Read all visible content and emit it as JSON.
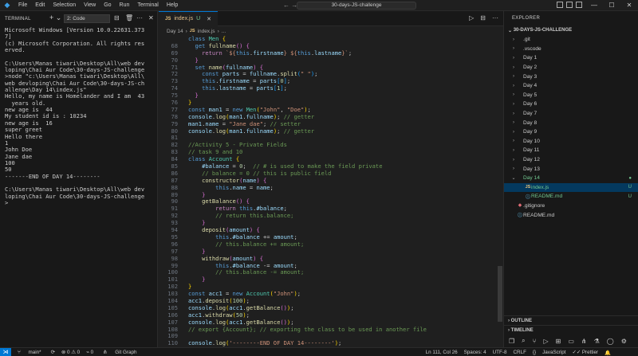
{
  "app": {
    "menu": [
      "File",
      "Edit",
      "Selection",
      "View",
      "Go",
      "Run",
      "Terminal",
      "Help"
    ],
    "search_text": "30-days-JS-challenge",
    "nav_back": "←",
    "nav_forward": "→"
  },
  "terminal": {
    "title": "TERMINAL",
    "selector": "2: Code",
    "lines": [
      "Microsoft Windows [Version 10.0.22631.373",
      "7]",
      "(c) Microsoft Corporation. All rights res",
      "erved.",
      "",
      "C:\\Users\\Manas tiwari\\Desktop\\All\\web dev",
      "loping\\Chai Aur Code\\30-days-JS-challenge",
      ">node \"c:\\Users\\Manas tiwari\\Desktop\\All\\",
      "web devloping\\Chai Aur Code\\30-days-JS-ch",
      "allenge\\Day 14\\index.js\"",
      "Hello, my name is Homelander and I am  43",
      "  years old.",
      "new age is  44",
      "My student id is : 10234",
      "new age is  16",
      "super greet",
      "Hello there",
      "1",
      "John Doe",
      "Jane dae",
      "100",
      "50",
      "-------END OF DAY 14--------",
      "",
      "C:\\Users\\Manas tiwari\\Desktop\\All\\web dev",
      "loping\\Chai Aur Code\\30-days-JS-challenge",
      ">"
    ]
  },
  "editor": {
    "tab": {
      "label": "index.js",
      "status": "U",
      "icon": "JS"
    },
    "breadcrumb": [
      "Day 14",
      "index.js",
      "..."
    ],
    "code": [
      {
        "ln": "",
        "html": "<span class=\"k\">class</span> <span class=\"c\">Men</span> <span class=\"p\">{</span>"
      },
      {
        "ln": "68",
        "html": "  <span class=\"k\">get</span> <span class=\"f\">fullname</span><span class=\"pp\">()</span> <span class=\"pp\">{</span>"
      },
      {
        "ln": "69",
        "html": "    <span class=\"kc\">return</span> <span class=\"s\">`${</span><span class=\"k\">this</span>.<span class=\"v\">firstname</span><span class=\"s\">} ${</span><span class=\"k\">this</span>.<span class=\"v\">lastname</span><span class=\"s\">}`</span>;"
      },
      {
        "ln": "70",
        "html": "  <span class=\"pp\">}</span>"
      },
      {
        "ln": "71",
        "html": "  <span class=\"k\">set</span> <span class=\"f\">name</span><span class=\"pp\">(</span><span class=\"v\">fullname</span><span class=\"pp\">)</span> <span class=\"pp\">{</span>"
      },
      {
        "ln": "72",
        "html": "    <span class=\"k\">const</span> <span class=\"v\">parts</span> = <span class=\"v\">fullname</span>.<span class=\"f\">split</span><span class=\"pb\">(</span><span class=\"s\">\" \"</span><span class=\"pb\">)</span>;"
      },
      {
        "ln": "73",
        "html": "    <span class=\"k\">this</span>.<span class=\"v\">firstname</span> = <span class=\"v\">parts</span><span class=\"pb\">[</span><span class=\"n\">0</span><span class=\"pb\">]</span>;"
      },
      {
        "ln": "74",
        "html": "    <span class=\"k\">this</span>.<span class=\"v\">lastname</span> = <span class=\"v\">parts</span><span class=\"pb\">[</span><span class=\"n\">1</span><span class=\"pb\">]</span>;"
      },
      {
        "ln": "75",
        "html": "  <span class=\"pp\">}</span>"
      },
      {
        "ln": "76",
        "html": "<span class=\"p\">}</span>"
      },
      {
        "ln": "77",
        "html": "<span class=\"k\">const</span> <span class=\"v\">man1</span> = <span class=\"k\">new</span> <span class=\"c\">Men</span><span class=\"p\">(</span><span class=\"s\">\"John\"</span>, <span class=\"s\">\"Doe\"</span><span class=\"p\">)</span>;"
      },
      {
        "ln": "78",
        "html": "<span class=\"v\">console</span>.<span class=\"f\">log</span><span class=\"p\">(</span><span class=\"v\">man1</span>.<span class=\"v\">fullname</span><span class=\"p\">)</span>; <span class=\"cm\">// getter</span>"
      },
      {
        "ln": "79",
        "html": "<span class=\"v\">man1</span>.<span class=\"v\">name</span> = <span class=\"s\">\"Jane dae\"</span>; <span class=\"cm\">// setter</span>"
      },
      {
        "ln": "80",
        "html": "<span class=\"v\">console</span>.<span class=\"f\">log</span><span class=\"p\">(</span><span class=\"v\">man1</span>.<span class=\"v\">fullname</span><span class=\"p\">)</span>; <span class=\"cm\">// getter</span>"
      },
      {
        "ln": "81",
        "html": ""
      },
      {
        "ln": "82",
        "html": "<span class=\"cm\">//Activity 5 - Private Fields</span>"
      },
      {
        "ln": "83",
        "html": "<span class=\"cm\">// task 9 and 10</span>"
      },
      {
        "ln": "84",
        "html": "<span class=\"k\">class</span> <span class=\"c\">Account</span> <span class=\"p\">{</span>"
      },
      {
        "ln": "85",
        "html": "    <span class=\"v\">#balance</span> = <span class=\"n\">0</span>;  <span class=\"cm\">// # is used to make the field private</span>"
      },
      {
        "ln": "86",
        "html": "    <span class=\"cm\">// balance = 0 // this is public field</span>"
      },
      {
        "ln": "87",
        "html": "    <span class=\"f\">constructor</span><span class=\"pp\">(</span><span class=\"v\">name</span><span class=\"pp\">)</span> <span class=\"pp\">{</span>"
      },
      {
        "ln": "88",
        "html": "        <span class=\"k\">this</span>.<span class=\"v\">name</span> = <span class=\"v\">name</span>;"
      },
      {
        "ln": "89",
        "html": "    <span class=\"pp\">}</span>"
      },
      {
        "ln": "90",
        "html": "    <span class=\"f\">getBalance</span><span class=\"pp\">()</span> <span class=\"pp\">{</span>"
      },
      {
        "ln": "91",
        "html": "        <span class=\"kc\">return</span> <span class=\"k\">this</span>.<span class=\"v\">#balance</span>;"
      },
      {
        "ln": "92",
        "html": "        <span class=\"cm\">// return this.balance;</span>"
      },
      {
        "ln": "93",
        "html": "    <span class=\"pp\">}</span>"
      },
      {
        "ln": "94",
        "html": "    <span class=\"f\">deposit</span><span class=\"pp\">(</span><span class=\"v\">amount</span><span class=\"pp\">)</span> <span class=\"pp\">{</span>"
      },
      {
        "ln": "95",
        "html": "        <span class=\"k\">this</span>.<span class=\"v\">#balance</span> += <span class=\"v\">amount</span>;"
      },
      {
        "ln": "96",
        "html": "        <span class=\"cm\">// this.balance += amount;</span>"
      },
      {
        "ln": "97",
        "html": "    <span class=\"pp\">}</span>"
      },
      {
        "ln": "98",
        "html": "    <span class=\"f\">withdraw</span><span class=\"pp\">(</span><span class=\"v\">amount</span><span class=\"pp\">)</span> <span class=\"pp\">{</span>"
      },
      {
        "ln": "99",
        "html": "        <span class=\"k\">this</span>.<span class=\"v\">#balance</span> -= <span class=\"v\">amount</span>;"
      },
      {
        "ln": "100",
        "html": "        <span class=\"cm\">// this.balance -= amount;</span>"
      },
      {
        "ln": "101",
        "html": "    <span class=\"pp\">}</span>"
      },
      {
        "ln": "102",
        "html": "<span class=\"p\">}</span>"
      },
      {
        "ln": "103",
        "html": "<span class=\"k\">const</span> <span class=\"v\">acc1</span> = <span class=\"k\">new</span> <span class=\"c\">Account</span><span class=\"p\">(</span><span class=\"s\">\"John\"</span><span class=\"p\">)</span>;"
      },
      {
        "ln": "104",
        "html": "<span class=\"v\">acc1</span>.<span class=\"f\">deposit</span><span class=\"p\">(</span><span class=\"n\">100</span><span class=\"p\">)</span>;"
      },
      {
        "ln": "105",
        "html": "<span class=\"v\">console</span>.<span class=\"f\">log</span><span class=\"p\">(</span><span class=\"v\">acc1</span>.<span class=\"f\">getBalance</span><span class=\"pp\">()</span><span class=\"p\">)</span>;"
      },
      {
        "ln": "106",
        "html": "<span class=\"v\">acc1</span>.<span class=\"f\">withdraw</span><span class=\"p\">(</span><span class=\"n\">50</span><span class=\"p\">)</span>;"
      },
      {
        "ln": "107",
        "html": "<span class=\"v\">console</span>.<span class=\"f\">log</span><span class=\"p\">(</span><span class=\"v\">acc1</span>.<span class=\"f\">getBalance</span><span class=\"pp\">()</span><span class=\"p\">)</span>;"
      },
      {
        "ln": "108",
        "html": "<span class=\"cm\">// export {Account}; // exporting the class to be used in another file</span>"
      },
      {
        "ln": "109",
        "html": ""
      },
      {
        "ln": "110",
        "html": "<span class=\"v\">console</span>.<span class=\"f\">log</span><span class=\"p\">(</span><span class=\"s\">'--------END OF DAY 14--------'</span><span class=\"p\">)</span>;"
      }
    ]
  },
  "explorer": {
    "title": "EXPLORER",
    "root": "30-DAYS-JS-CHALLENGE",
    "items": [
      {
        "label": ".git",
        "type": "folder",
        "depth": 0
      },
      {
        "label": ".vscode",
        "type": "folder",
        "depth": 0
      },
      {
        "label": "Day 1",
        "type": "folder",
        "depth": 0
      },
      {
        "label": "Day 2",
        "type": "folder",
        "depth": 0
      },
      {
        "label": "Day 3",
        "type": "folder",
        "depth": 0
      },
      {
        "label": "Day 4",
        "type": "folder",
        "depth": 0
      },
      {
        "label": "Day 5",
        "type": "folder",
        "depth": 0
      },
      {
        "label": "Day 6",
        "type": "folder",
        "depth": 0
      },
      {
        "label": "Day 7",
        "type": "folder",
        "depth": 0
      },
      {
        "label": "Day 8",
        "type": "folder",
        "depth": 0
      },
      {
        "label": "Day 9",
        "type": "folder",
        "depth": 0
      },
      {
        "label": "Day 10",
        "type": "folder",
        "depth": 0
      },
      {
        "label": "Day 11",
        "type": "folder",
        "depth": 0
      },
      {
        "label": "Day 12",
        "type": "folder",
        "depth": 0
      },
      {
        "label": "Day 13",
        "type": "folder",
        "depth": 0
      },
      {
        "label": "Day 14",
        "type": "folder-open",
        "depth": 0,
        "badge": "●"
      },
      {
        "label": "index.js",
        "type": "js",
        "depth": 1,
        "badge": "U",
        "active": true
      },
      {
        "label": "README.md",
        "type": "md",
        "depth": 1,
        "badge": "U"
      },
      {
        "label": ".gitignore",
        "type": "git",
        "depth": 0
      },
      {
        "label": "README.md",
        "type": "md",
        "depth": 0
      }
    ],
    "outline": "OUTLINE",
    "timeline": "TIMELINE"
  },
  "statusbar": {
    "branch": "main*",
    "sync": "⟳",
    "problems": "⊗ 0 ⚠ 0",
    "ports": "⌁ 0",
    "git_graph": "Git Graph",
    "position": "Ln 111, Col 26",
    "spaces": "Spaces: 4",
    "encoding": "UTF-8",
    "eol": "CRLF",
    "braces": "{}",
    "language": "JavaScript",
    "prettier": "✓✓ Prettier"
  },
  "colors": {
    "accent": "#0078d4",
    "bg": "#1f1f1f",
    "panel": "#181818",
    "untracked": "#73c991",
    "modified_label": "#e2c08d"
  }
}
